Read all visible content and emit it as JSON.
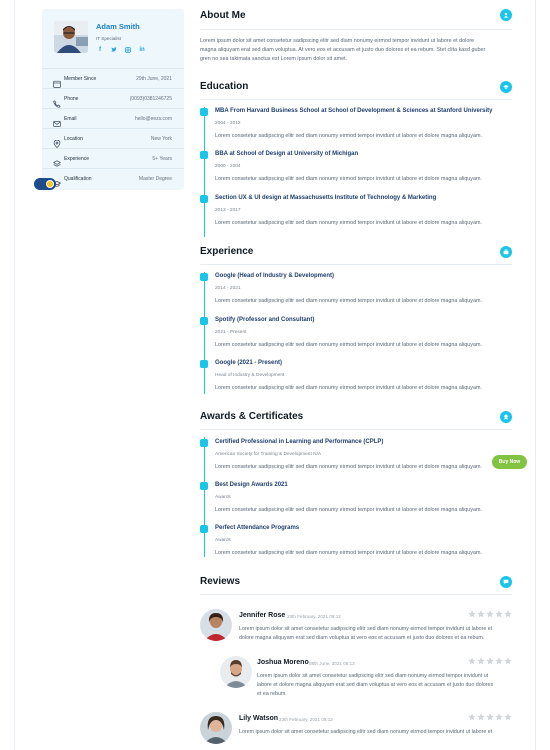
{
  "profile": {
    "name": "Adam Smith",
    "role": "IT Specialist",
    "socials": [
      "facebook-icon",
      "twitter-icon",
      "instagram-icon",
      "linkedin-icon"
    ],
    "details": [
      {
        "icon": "calendar-icon",
        "label": "Member Since",
        "value": "29th June, 2021"
      },
      {
        "icon": "phone-icon",
        "label": "Phone",
        "value": "(0093)0381246725"
      },
      {
        "icon": "mail-icon",
        "label": "Email",
        "value": "hello@eezs.com"
      },
      {
        "icon": "location-icon",
        "label": "Location",
        "value": "New York"
      },
      {
        "icon": "layers-icon",
        "label": "Experience",
        "value": "5+ Years"
      },
      {
        "icon": "graduation-icon",
        "label": "Qualification",
        "value": "Master Degree"
      }
    ]
  },
  "about": {
    "title": "About Me",
    "lines": [
      "Lorem ipsum dolor sit amet consetetur sadipscing elitr sed diam nonumy eirmod tempor invidunt ut labore et dolore",
      "magna aliquyam erat sed diam voluptua. At vero eos et accusam et justo duo dolores et ea rebum. Stet clita kasd guber",
      "gren no sea takimata sanctus est Lorem ipsum dolor sit amet."
    ]
  },
  "education": {
    "title": "Education",
    "items": [
      {
        "title": "MBA From Harvard Business School at School of Development & Sciences at Stanford University",
        "sub": "2004 - 2012",
        "desc": "Lorem consetetur sadipscing elitr sed diam nonumy eirmod tempor invidunt ut labore et dolore magna aliquyam."
      },
      {
        "title": "BBA at School of Design at University of Michigan",
        "sub": "2000 - 2004",
        "desc": "Lorem consetetur sadipscing elitr sed diam nonumy eirmod tempor invidunt ut labore et dolore magna aliquyam."
      },
      {
        "title": "Section UX & UI design at Massachusetts Institute of Technology & Marketing",
        "sub": "2013 - 2017",
        "desc": "Lorem consetetur sadipscing elitr sed diam nonumy eirmod tempor invidunt ut labore et dolore magna aliquyam."
      }
    ]
  },
  "experience": {
    "title": "Experience",
    "items": [
      {
        "title": "Google (Head of Industry & Development)",
        "sub": "2014 - 2021",
        "desc": "Lorem consetetur sadipscing elitr sed diam nonumy eirmod tempor invidunt ut labore et dolore magna aliquyam."
      },
      {
        "title": "Spotify (Professor and Consultant)",
        "sub": "2021 - Present",
        "desc": "Lorem consetetur sadipscing elitr sed diam nonumy eirmod tempor invidunt ut labore et dolore magna aliquyam."
      },
      {
        "title": "Google (2021 - Present)",
        "sub": "Head of Industry & Development",
        "desc": "Lorem consetetur sadipscing elitr sed diam nonumy eirmod tempor invidunt ut labore et dolore magna aliquyam."
      }
    ]
  },
  "awards": {
    "title": "Awards & Certificates",
    "items": [
      {
        "title": "Certified Professional in Learning and Performance (CPLP)",
        "sub": "American Society for Training & Development N/A",
        "desc": "Lorem consetetur sadipscing elitr sed diam nonumy eirmod tempor invidunt ut labore et dolore magna aliquyam."
      },
      {
        "title": "Best Design Awards 2021",
        "sub": "Awards",
        "desc": "Lorem consetetur sadipscing elitr sed diam nonumy eirmod tempor invidunt ut labore et dolore magna aliquyam."
      },
      {
        "title": "Perfect Attendance Programs",
        "sub": "Awards",
        "desc": "Lorem consetetur sadipscing elitr sed diam nonumy eirmod tempor invidunt ut labore et dolore magna aliquyam."
      }
    ]
  },
  "buy_now": "Buy Now",
  "reviews": {
    "title": "Reviews",
    "items": [
      {
        "name": "Jennifer Rose",
        "date": "23th February, 2021 09:12",
        "rating": 5,
        "lines": [
          "Lorem ipsum dolor sit amet consetetur sadipscing elitr sed diam nonumy eirmod tempor invidunt ut labore et",
          "dolore magna aliquyam erat sed diam voluptua at vero eos et accusam et justo duo dolores et ea rebum."
        ]
      },
      {
        "name": "Joshua Moreno",
        "date": "08th June, 2021 05:12",
        "rating": 5,
        "lines": [
          "Lorem ipsum dolor sit amet consetetur sadipscing elitr sed diam nonumy eirmod tempor invidunt ut",
          "labore et dolore magna aliquyam erat sed diam voluptua at vero eos et accusam et justo duo dolores",
          "et ea rebum."
        ]
      },
      {
        "name": "Lily Watson",
        "date": "23th February, 2021 09:12",
        "rating": 5,
        "lines": [
          "Lorem ipsum dolor sit amet consetetur sadipscing elitr sed diam nonumy eirmod tempor invidunt ut labore et"
        ]
      }
    ]
  },
  "colors": {
    "accent": "#19c6ea",
    "brand": "#1d80c8",
    "sidebar_bg": "#eef7fc",
    "buy": "#82c341",
    "toggle": "#1f4c8a"
  }
}
